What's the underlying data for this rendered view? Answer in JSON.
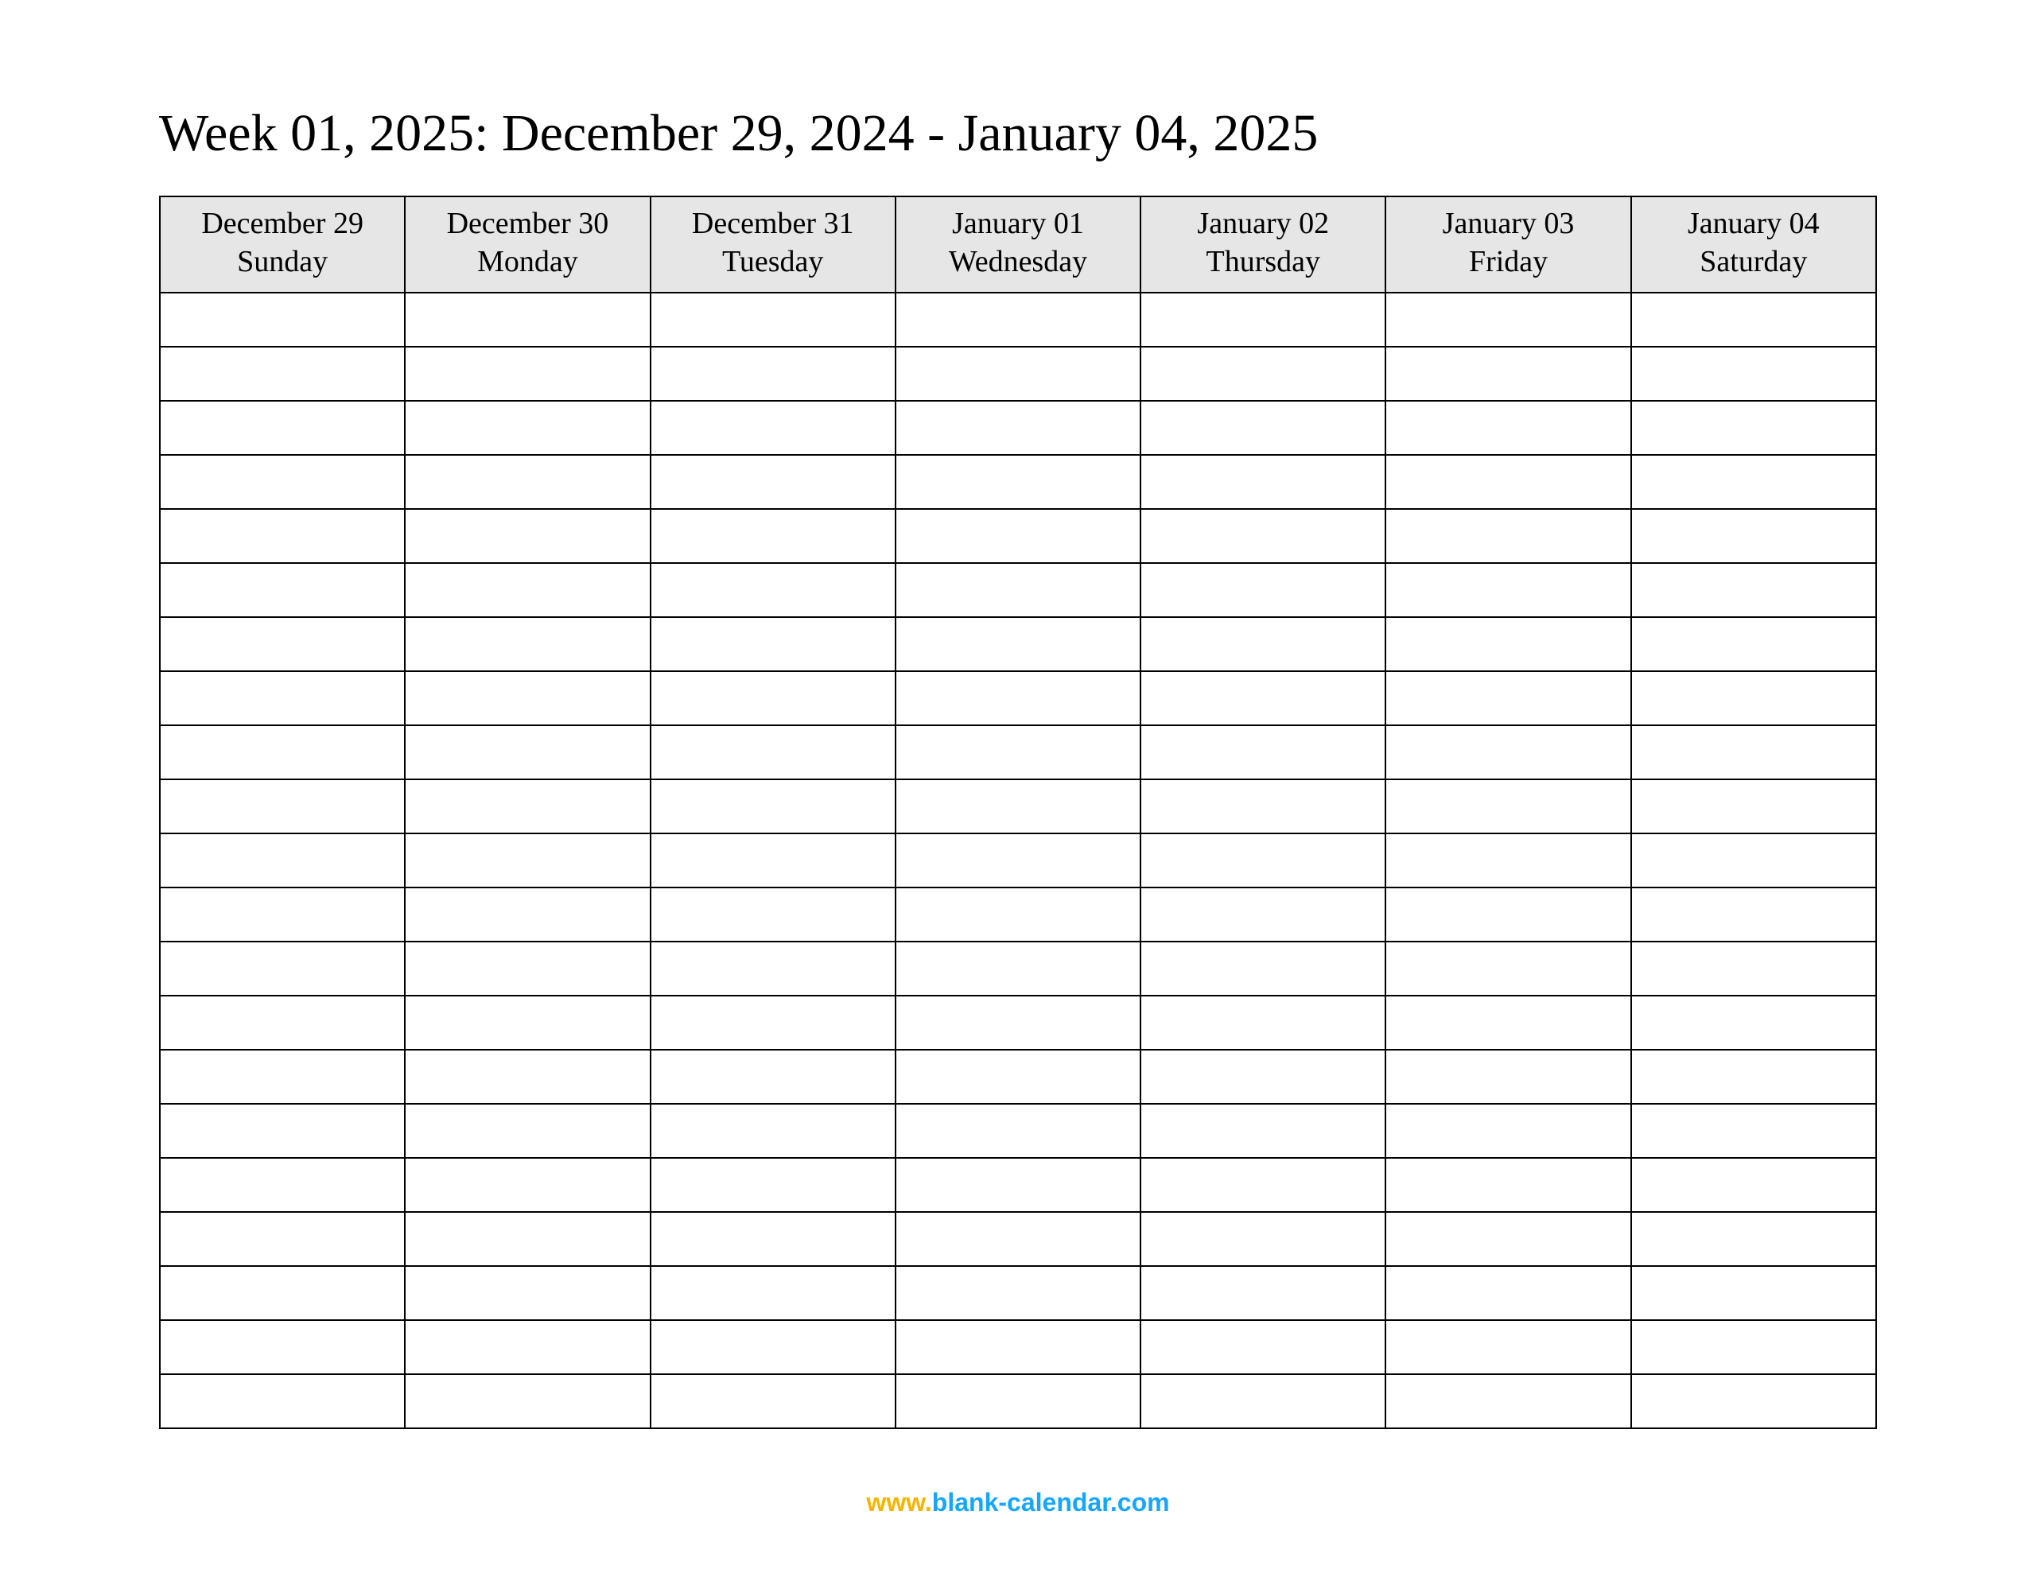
{
  "title": "Week 01, 2025: December 29, 2024 - January 04, 2025",
  "columns": [
    {
      "date": "December 29",
      "dow": "Sunday"
    },
    {
      "date": "December 30",
      "dow": "Monday"
    },
    {
      "date": "December 31",
      "dow": "Tuesday"
    },
    {
      "date": "January 01",
      "dow": "Wednesday"
    },
    {
      "date": "January 02",
      "dow": "Thursday"
    },
    {
      "date": "January 03",
      "dow": "Friday"
    },
    {
      "date": "January 04",
      "dow": "Saturday"
    }
  ],
  "body_row_count": 21,
  "footer": {
    "www": "www.",
    "domain": "blank-calendar.com"
  }
}
